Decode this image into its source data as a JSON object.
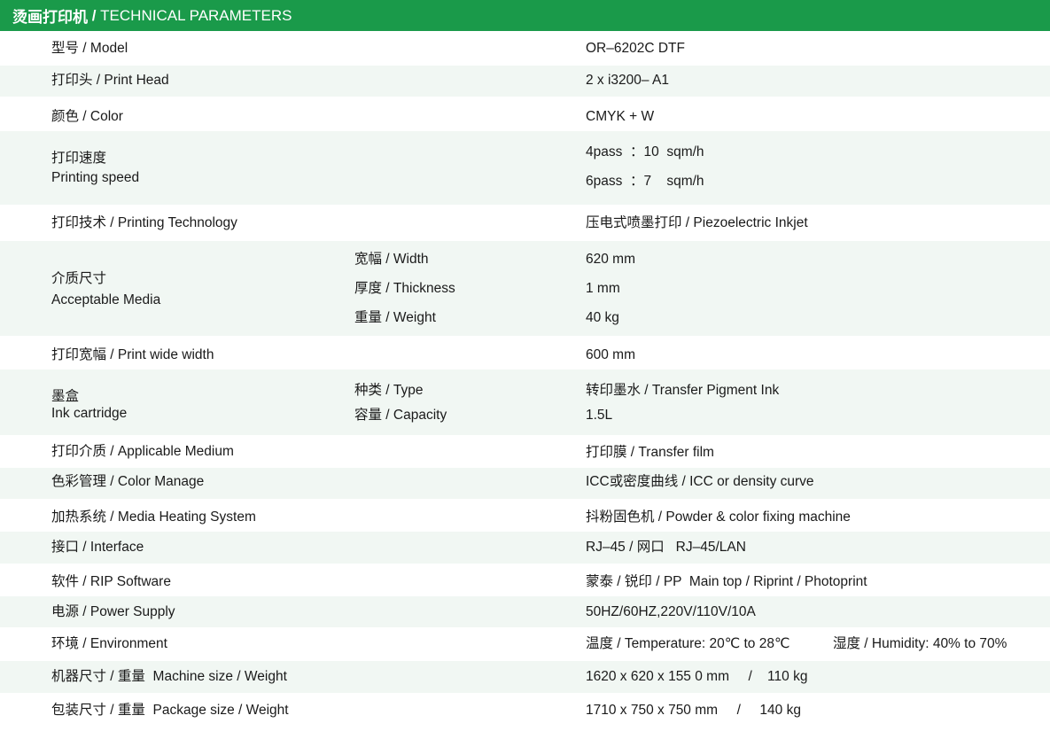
{
  "header": {
    "title_cn": "烫画打印机",
    "separator": " / ",
    "title_en": "TECHNICAL PARAMETERS"
  },
  "rows": {
    "model": {
      "label": "型号 /  Model",
      "value": "OR–6202C DTF"
    },
    "print_head": {
      "label": "打印头 /  Print Head",
      "value": "2 x i3200– A1"
    },
    "color": {
      "label": "颜色 /  Color",
      "value": "CMYK + W"
    },
    "printing_speed": {
      "label_cn": "打印速度",
      "label_en": "Printing speed",
      "value_1": "4pass  ：10  sqm/h",
      "value_2": "6pass  ：7    sqm/h"
    },
    "printing_technology": {
      "label": "打印技术 /  Printing Technology",
      "value": "压电式喷墨打印 /  Piezoelectric Inkjet"
    },
    "acceptable_media": {
      "label_cn": "介质尺寸",
      "label_en": "Acceptable Media",
      "width_label": "宽幅 / Width",
      "width_value": "620 mm",
      "thickness_label": "厚度 / Thickness",
      "thickness_value": "1 mm",
      "weight_label": "重量 / Weight",
      "weight_value": "40 kg"
    },
    "print_width": {
      "label": "打印宽幅 / Print wide width",
      "value": "600 mm"
    },
    "ink_cartridge": {
      "label_cn": "墨盒",
      "label_en": "Ink cartridge",
      "type_label": "种类 / Type",
      "type_value": "转印墨水 /  Transfer Pigment Ink",
      "capacity_label": "容量 / Capacity",
      "capacity_value": "1.5L"
    },
    "applicable_medium": {
      "label": "打印介质 / Applicable Medium",
      "value": "打印膜 /  Transfer film"
    },
    "color_manage": {
      "label": "色彩管理 / Color Manage",
      "value": "ICC或密度曲线 /  ICC or density curve"
    },
    "heating_system": {
      "label": "加热系统 /  Media Heating System",
      "value": "抖粉固色机 /  Powder & color fixing machine"
    },
    "interface": {
      "label": "接口 /  Interface",
      "value": "RJ–45 / 网口   RJ–45/LAN"
    },
    "software": {
      "label": "软件 /  RIP Software",
      "value": "蒙泰 / 锐印 / PP  Main top / Riprint / Photoprint"
    },
    "power_supply": {
      "label": "电源 /  Power Supply",
      "value": "50HZ/60HZ,220V/110V/10A"
    },
    "environment": {
      "label": "环境 / Environment",
      "value_temp": "温度 / Temperature: 20℃ to 28℃",
      "value_humidity": "湿度 / Humidity: 40% to 70%"
    },
    "machine_size": {
      "label": "机器尺寸 / 重量  Machine size / Weight",
      "value": "1620 x 620 x 155 0 mm     /    110 kg"
    },
    "package_size": {
      "label": "包装尺寸 / 重量  Package size / Weight",
      "value": "1710 x 750 x 750 mm     /     140 kg"
    }
  }
}
